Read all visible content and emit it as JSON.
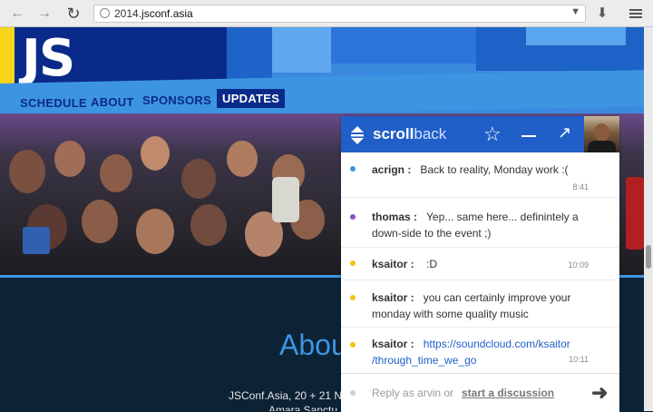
{
  "browser": {
    "url_host": "2014.",
    "url_domain": "jsconf.asia",
    "icons": {
      "back": "arrow-left-icon",
      "forward": "arrow-right-icon",
      "reload": "reload-icon",
      "download": "download-icon",
      "menu": "hamburger-icon"
    }
  },
  "site": {
    "logo": "JS",
    "nav": [
      "SCHEDULE",
      "ABOUT",
      "SPONSORS",
      "UPDATES"
    ],
    "about_title": "Abou",
    "about_line1": "JSConf.Asia, 20 + 21 No",
    "about_line2": "Amara Sanctu",
    "colors": {
      "accent_blue": "#3d95e2",
      "dark_navy": "#0a2a8a",
      "yellow": "#f7d51d"
    }
  },
  "scrollback": {
    "brand_bold": "scroll",
    "brand_light": "back",
    "brand_color": "#1f5fc7",
    "messages": [
      {
        "nick": "acrign :",
        "text": "Back to reality, Monday work :(",
        "time": "8:41",
        "dot_color": "#3d95e2"
      },
      {
        "nick": "thomas :",
        "text": "Yep... same here... definintely a down-side to the event ;)",
        "time": "",
        "dot_color": "#8a4fc4"
      },
      {
        "nick": "ksaitor :",
        "text": ":D",
        "time": "10:09",
        "dot_color": "#f2c40e"
      },
      {
        "nick": "ksaitor :",
        "text": "you can certainly improve your monday with some quality music",
        "time": "",
        "dot_color": "#f2c40e"
      },
      {
        "nick": "ksaitor :",
        "text": "https://soundcloud.com/ksaitor/through_time_we_go",
        "link_line1": "https://soundcloud.com/ksaitor",
        "link_line2": "/through_time_we_go",
        "time": "10:11",
        "dot_color": "#f2c40e"
      }
    ],
    "compose_placeholder": "Reply as arvin or",
    "compose_link": "start a discussion"
  }
}
